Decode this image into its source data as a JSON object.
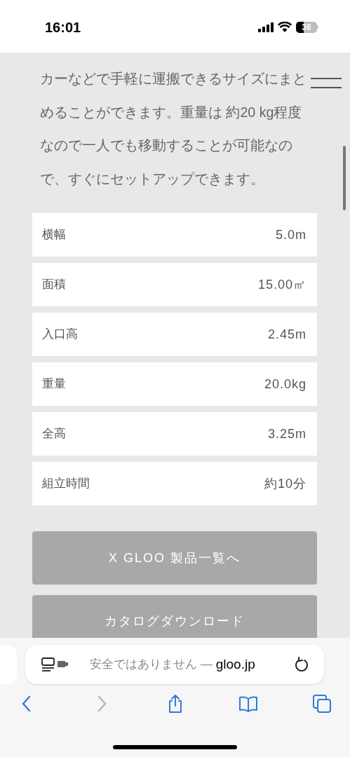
{
  "status_bar": {
    "time": "16:01",
    "battery": "36"
  },
  "paragraph": "カーなどで手軽に運搬できるサイズにまとめることができます。重量は 約20 kg程度なので一人でも移動することが可能なので、すぐにセットアップできます。",
  "specs": [
    {
      "label": "横幅",
      "value": "5.0m"
    },
    {
      "label": "面積",
      "value": "15.00㎡"
    },
    {
      "label": "入口高",
      "value": "2.45m"
    },
    {
      "label": "重量",
      "value": "20.0kg"
    },
    {
      "label": "全高",
      "value": "3.25m"
    },
    {
      "label": "組立時間",
      "value": "約10分"
    }
  ],
  "buttons": [
    "X GLOO 製品一覧へ",
    "カタログダウンロード"
  ],
  "address_bar": {
    "security": "安全ではありません —",
    "domain": "gloo.jp"
  },
  "toolbar": [
    {
      "kind": "back",
      "disabled": false
    },
    {
      "kind": "forward",
      "disabled": true
    },
    {
      "kind": "share",
      "disabled": false
    },
    {
      "kind": "bookmarks",
      "disabled": false
    },
    {
      "kind": "tabs",
      "disabled": false
    }
  ]
}
